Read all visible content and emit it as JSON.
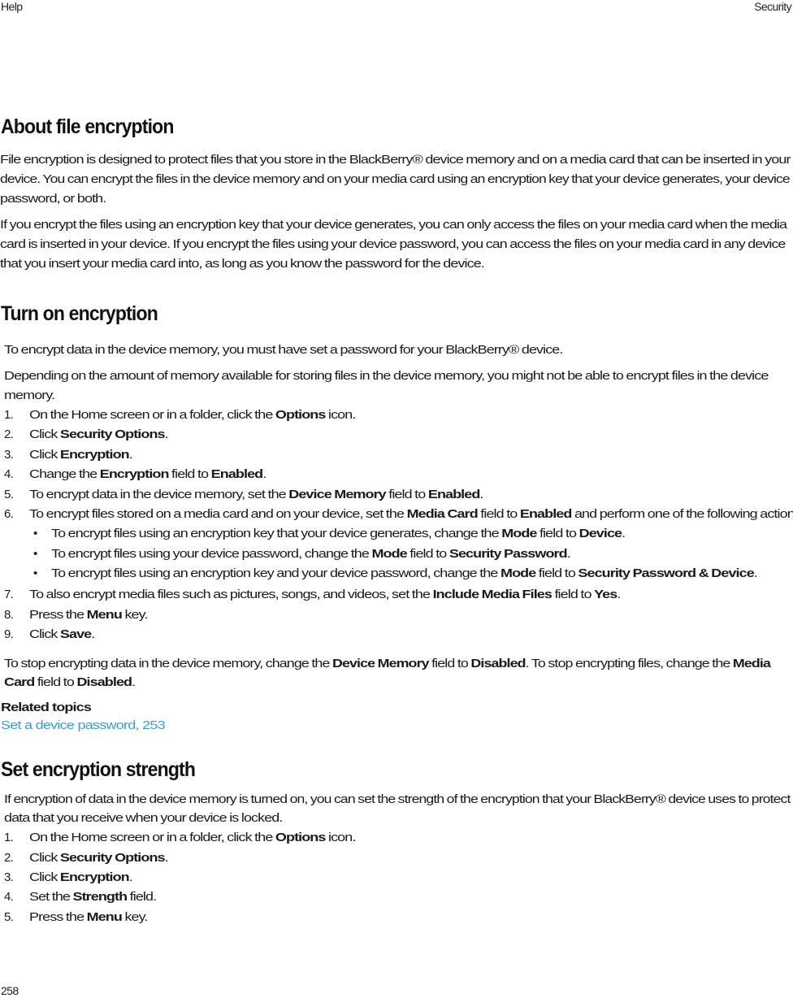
{
  "header": {
    "left": "Help",
    "right": "Security"
  },
  "footer": {
    "page_number": "258"
  },
  "sections": {
    "about": {
      "title": "About file encryption",
      "para1_line1": "File encryption is designed to protect files that you store in the BlackBerry® device memory and on a media card that can be inserted in your",
      "para1_line2": "device. You can encrypt the files in the device memory and on your media card using an encryption key that your device generates, your device",
      "para1_line3": "password, or both.",
      "para2_line1": "If you encrypt the files using an encryption key that your device generates, you can only access the files on your media card when the media",
      "para2_line2": "card is inserted in your device. If you encrypt the files using your device password, you can access the files on your media card in any device",
      "para2_line3": "that you insert your media card into, as long as you know the password for the device."
    },
    "turn_on": {
      "title": "Turn on encryption",
      "intro1": "To encrypt data in the device memory, you must have set a password for your BlackBerry® device.",
      "intro2_line1": "Depending on the amount of memory available for storing files in the device memory, you might not be able to encrypt files in the device",
      "intro2_line2": "memory.",
      "steps": [
        {
          "num": "1.",
          "pre": "On the Home screen or in a folder, click the ",
          "b1": "Options",
          "mid": " icon.",
          "b2": "",
          "post": ""
        },
        {
          "num": "2.",
          "pre": "Click ",
          "b1": "Security Options",
          "mid": ".",
          "b2": "",
          "post": ""
        },
        {
          "num": "3.",
          "pre": "Click ",
          "b1": "Encryption",
          "mid": ".",
          "b2": "",
          "post": ""
        },
        {
          "num": "4.",
          "pre": "Change the ",
          "b1": "Encryption",
          "mid": " field to ",
          "b2": "Enabled",
          "post": "."
        },
        {
          "num": "5.",
          "pre": "To encrypt data in the device memory, set the ",
          "b1": "Device Memory",
          "mid": " field to ",
          "b2": "Enabled",
          "post": "."
        },
        {
          "num": "6.",
          "pre": "To encrypt files stored on a media card and on your device, set the ",
          "b1": "Media Card",
          "mid": " field to ",
          "b2": "Enabled",
          "post": " and perform one of the following actions:"
        },
        {
          "num": "7.",
          "pre": "To also encrypt media files such as pictures, songs, and videos, set the ",
          "b1": "Include Media Files",
          "mid": " field to ",
          "b2": "Yes",
          "post": "."
        },
        {
          "num": "8.",
          "pre": "Press the ",
          "b1": "Menu",
          "mid": " key.",
          "b2": "",
          "post": ""
        },
        {
          "num": "9.",
          "pre": "Click ",
          "b1": "Save",
          "mid": ".",
          "b2": "",
          "post": ""
        }
      ],
      "bullets": [
        {
          "pre": "To encrypt files using an encryption key that your device generates, change the ",
          "b1": "Mode",
          "mid": " field to ",
          "b2": "Device",
          "post": "."
        },
        {
          "pre": "To encrypt files using your device password, change the ",
          "b1": "Mode",
          "mid": " field to ",
          "b2": "Security Password",
          "post": "."
        },
        {
          "pre": "To encrypt files using an encryption key and your device password, change the ",
          "b1": "Mode",
          "mid": " field to ",
          "b2": "Security Password & Device",
          "post": "."
        }
      ],
      "stop_line1": {
        "pre": "To stop encrypting data in the device memory, change the ",
        "b1": "Device Memory",
        "mid": " field to ",
        "b2": "Disabled",
        "post": ". To stop encrypting files, change the ",
        "b3": "Media"
      },
      "stop_line2": {
        "b1": "Card",
        "mid": " field to ",
        "b2": "Disabled",
        "post": "."
      },
      "related_label": "Related topics",
      "related_link": "Set a device password, 253"
    },
    "strength": {
      "title": "Set encryption strength",
      "intro_line1": "If encryption of data in the device memory is turned on, you can set the strength of the encryption that your BlackBerry® device uses to protect",
      "intro_line2": "data that you receive when your device is locked.",
      "steps": [
        {
          "num": "1.",
          "pre": "On the Home screen or in a folder, click the ",
          "b1": "Options",
          "mid": " icon."
        },
        {
          "num": "2.",
          "pre": "Click ",
          "b1": "Security Options",
          "mid": "."
        },
        {
          "num": "3.",
          "pre": "Click ",
          "b1": "Encryption",
          "mid": "."
        },
        {
          "num": "4.",
          "pre": "Set the ",
          "b1": "Strength",
          "mid": " field."
        },
        {
          "num": "5.",
          "pre": "Press the ",
          "b1": "Menu",
          "mid": " key."
        }
      ]
    }
  }
}
